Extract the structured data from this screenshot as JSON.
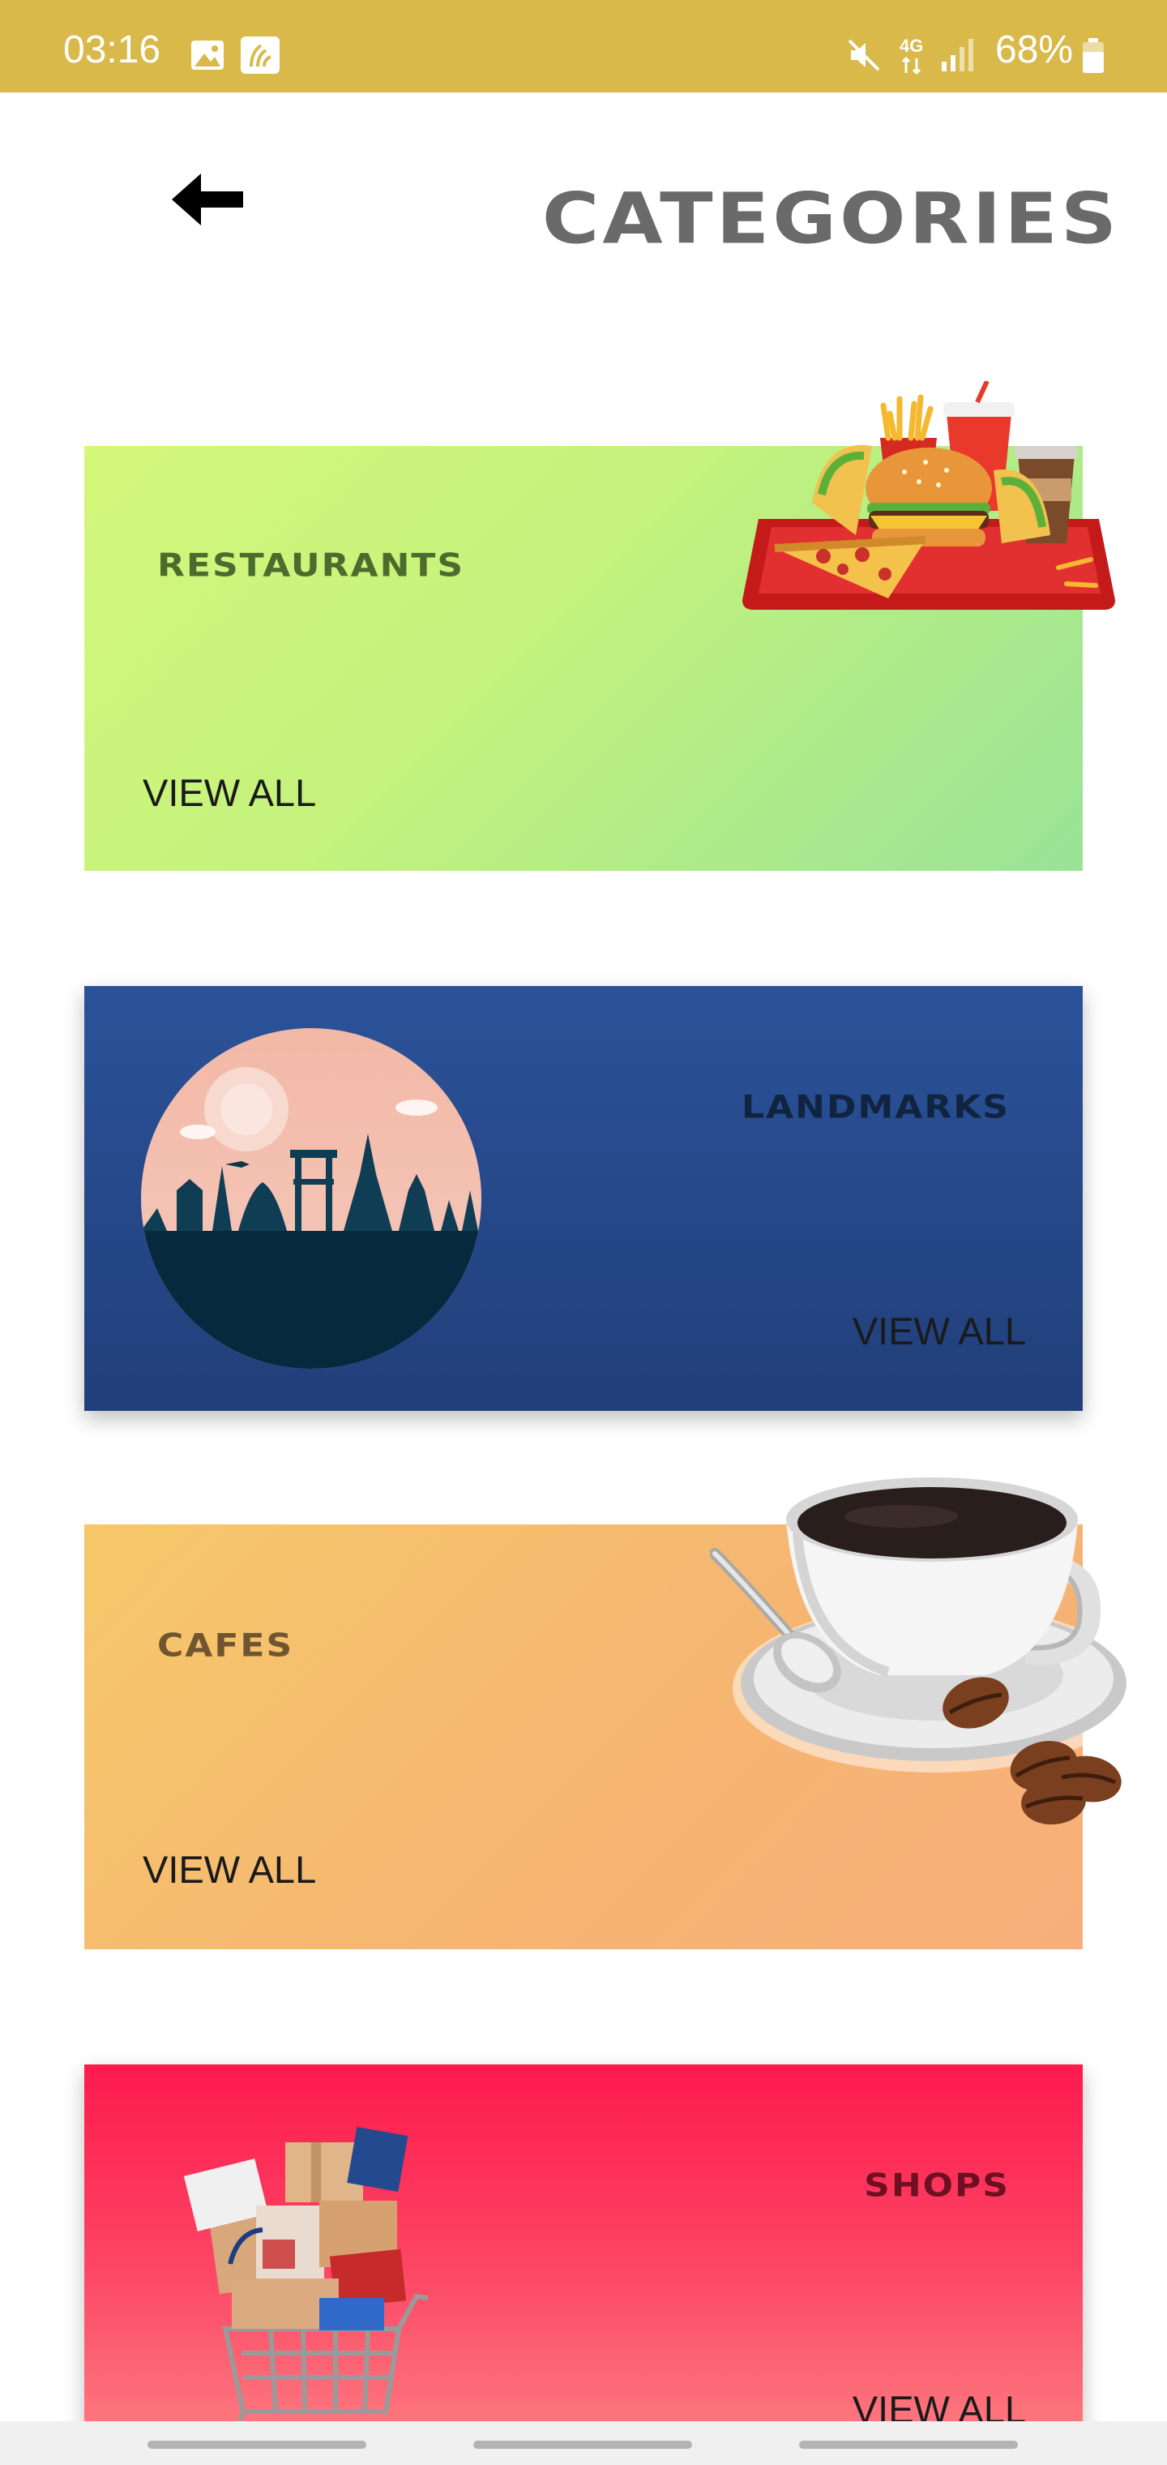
{
  "status_bar": {
    "time": "03:16",
    "network": "4G",
    "battery": "68%",
    "icons": [
      "image-icon",
      "app-notification-icon",
      "mute-icon",
      "network-4g-icon",
      "signal-icon",
      "battery-icon"
    ]
  },
  "header": {
    "back_icon": "back-arrow-icon",
    "title": "CATEGORIES"
  },
  "categories": [
    {
      "title": "RESTAURANTS",
      "action": "VIEW ALL",
      "illustration": "fast-food-tray",
      "title_color": "#4c6c2e"
    },
    {
      "title": "LANDMARKS",
      "action": "VIEW ALL",
      "illustration": "city-skyline-circle",
      "title_color": "#10233f"
    },
    {
      "title": "CAFES",
      "action": "VIEW ALL",
      "illustration": "coffee-cup",
      "title_color": "#6f5630"
    },
    {
      "title": "SHOPS",
      "action": "VIEW ALL",
      "illustration": "shopping-cart",
      "title_color": "#6e1022"
    }
  ],
  "colors": {
    "status_bar": "#d9b94a",
    "restaurants_gradient": [
      "#d5f77b",
      "#99e397"
    ],
    "landmarks_gradient": [
      "#2b5299",
      "#213f7a"
    ],
    "cafes_gradient": [
      "#f6c86a",
      "#f8ae7a"
    ],
    "shops_gradient": [
      "#fd1a4c",
      "#fb8283"
    ]
  }
}
